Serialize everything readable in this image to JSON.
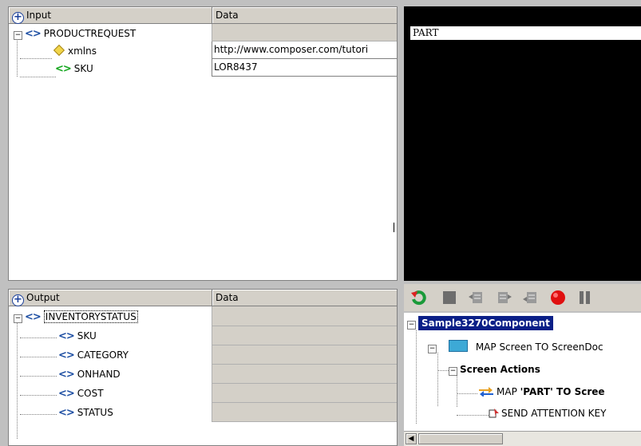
{
  "input_pane": {
    "col1": "Input",
    "col2": "Data",
    "rows": [
      {
        "label": "PRODUCTREQUEST",
        "value": ""
      },
      {
        "label": "xmlns",
        "value": "http://www.composer.com/tutori"
      },
      {
        "label": "SKU",
        "value": "LOR8437"
      }
    ]
  },
  "output_pane": {
    "col1": "Output",
    "col2": "Data",
    "rows": [
      {
        "label": "INVENTORYSTATUS"
      },
      {
        "label": "SKU"
      },
      {
        "label": "CATEGORY"
      },
      {
        "label": "ONHAND"
      },
      {
        "label": "COST"
      },
      {
        "label": "STATUS"
      }
    ]
  },
  "terminal": {
    "line": "PART"
  },
  "actions_tree": {
    "root": "Sample3270Component",
    "map_screen": "MAP Screen TO ScreenDoc",
    "screen_actions": "Screen Actions",
    "map_part_prefix": "MAP ",
    "map_part_bold": "'PART' TO Scree",
    "send_attention": "SEND ATTENTION KEY"
  },
  "toolbar_icons": [
    "refresh-icon",
    "stop-icon",
    "step-back-icon",
    "step-icon",
    "step-into-icon",
    "record-icon",
    "pause-icon"
  ]
}
